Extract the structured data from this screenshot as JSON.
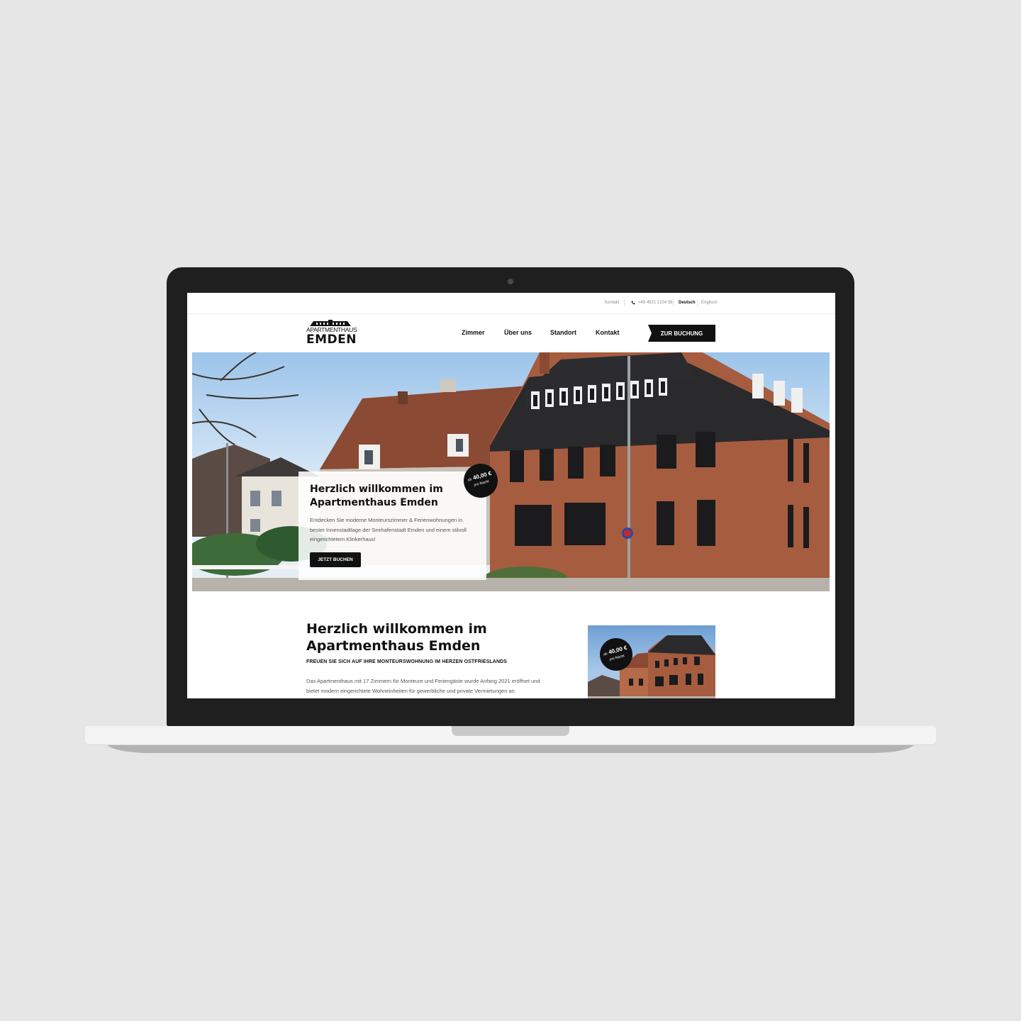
{
  "topbar": {
    "kontakt": "Kontakt",
    "phone": "+49 4921 1234 56",
    "lang_de": "Deutsch",
    "lang_en": "Englisch"
  },
  "logo": {
    "top": "APARTMENTHAUS",
    "main": "EMDEN"
  },
  "nav": {
    "items": [
      "Zimmer",
      "Über uns",
      "Standort",
      "Kontakt"
    ],
    "cta": "ZUR BUCHUNG"
  },
  "hero": {
    "title": "Herzlich willkommen im Apartmenthaus Emden",
    "text": "Entdecken Sie moderne Monteurszimmer & Ferienwohnungen in bester Innenstadtlage der Seehafenstadt Emden und einem stilvoll eingerichtetem Klinkerhaus!",
    "button": "JETZT BUCHEN"
  },
  "badge": {
    "prefix": "ab",
    "price": "40,00 €",
    "unit": "pro Nacht"
  },
  "section": {
    "title": "Herzlich willkommen im Apartmenthaus Emden",
    "subtitle": "FREUEN SIE SICH AUF IHRE MONTEURSWOHNUNG IM HERZEN OSTFRIESLANDS",
    "text": "Das Apartmenthaus mit 17 Zimmern für Monteure und Feriengäste wurde Anfang 2021 eröffnet und bietet modern eingerichtete Wohneinheiten für gewerbliche und private Vermietungen an."
  },
  "icons": {
    "phone": "phone-icon",
    "camera": "webcam-icon",
    "logo_roof": "house-roof-icon"
  },
  "colors": {
    "page_bg": "#e6e6e6",
    "laptop_bezel": "#1f1f1f",
    "accent": "#111111",
    "brick": "#a65c3f"
  }
}
